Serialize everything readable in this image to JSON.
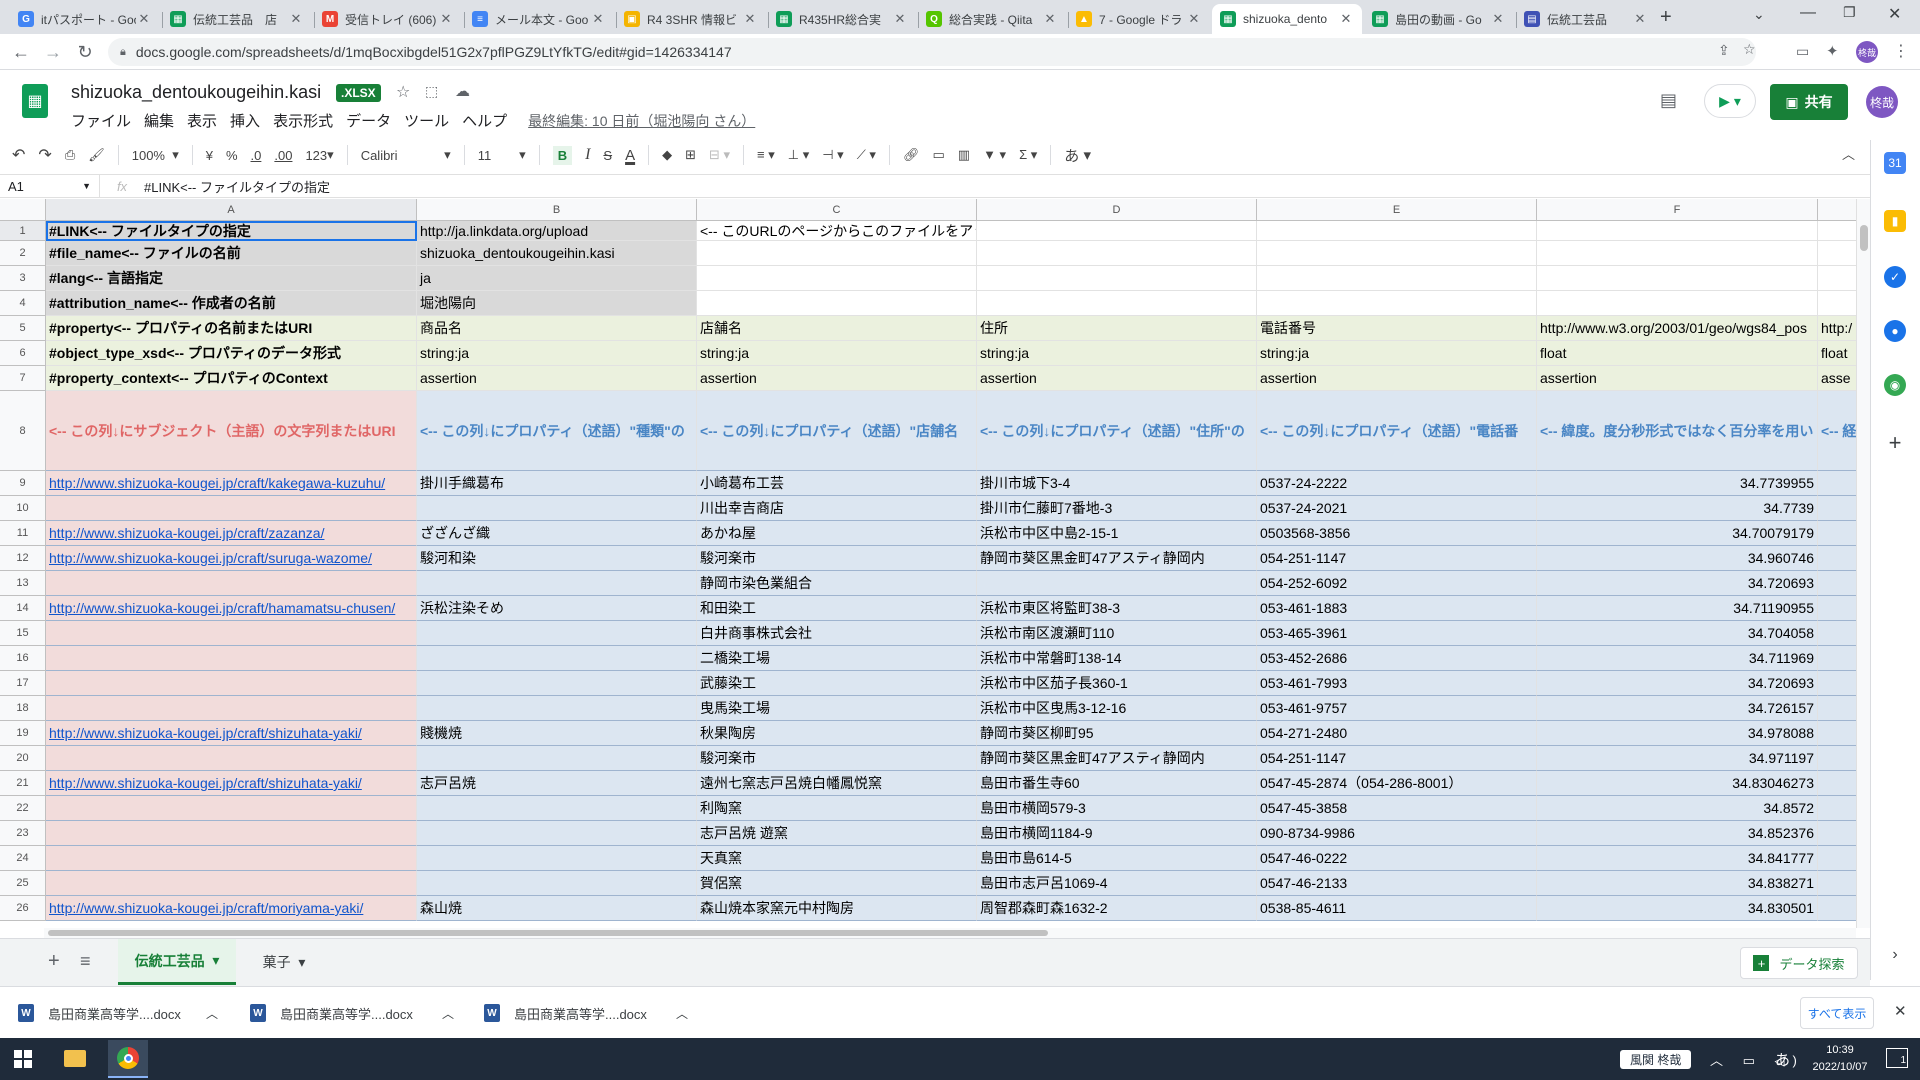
{
  "browser": {
    "tabs": [
      {
        "label": "itパスポート - Goo",
        "color": "#4285f4",
        "glyph": "G"
      },
      {
        "label": "伝統工芸品　店",
        "color": "#0f9d58",
        "glyph": "▦"
      },
      {
        "label": "受信トレイ (606)",
        "color": "#ea4335",
        "glyph": "M"
      },
      {
        "label": "メール本文 - Goo",
        "color": "#4285f4",
        "glyph": "≡"
      },
      {
        "label": "R4 3SHR 情報ビ",
        "color": "#f4b400",
        "glyph": "▣"
      },
      {
        "label": "R435HR総合実",
        "color": "#0f9d58",
        "glyph": "▦"
      },
      {
        "label": "総合実践 - Qiita",
        "color": "#55c500",
        "glyph": "Q"
      },
      {
        "label": "7 - Google ドラ",
        "color": "#fbbc04",
        "glyph": "▲"
      },
      {
        "label": "shizuoka_dento",
        "color": "#0f9d58",
        "glyph": "▦"
      },
      {
        "label": "島田の動画 - Go",
        "color": "#0f9d58",
        "glyph": "▦"
      },
      {
        "label": "伝統工芸品",
        "color": "#3f51b5",
        "glyph": "▤"
      }
    ],
    "url": "docs.google.com/spreadsheets/d/1mqBocxibgdel51G2x7pflPGZ9LtYfkTG/edit#gid=1426334147",
    "new_tab": "+",
    "profile_initials": "柊哉"
  },
  "sheets": {
    "doc_title": "shizuoka_dentoukougeihin.kasi",
    "badge": ".XLSX",
    "menu": [
      "ファイル",
      "編集",
      "表示",
      "挿入",
      "表示形式",
      "データ",
      "ツール",
      "ヘルプ"
    ],
    "last_edit": "最終編集: 10 日前（堀池陽向 さん）",
    "share_label": "共有",
    "avatar": "柊哉"
  },
  "toolbar": {
    "zoom": "100%",
    "currency": "¥",
    "percent": "%",
    "dec_less": ".0",
    "dec_more": ".00",
    "format_num": "123",
    "font": "Calibri",
    "size": "11",
    "bold": "B",
    "italic": "I",
    "strike": "S",
    "text_color": "A",
    "input_tool": "あ"
  },
  "formula_bar": {
    "cell_ref": "A1",
    "fx": "fx",
    "content": "#LINK<-- ファイルタイプの指定"
  },
  "grid": {
    "columns": [
      "A",
      "B",
      "C",
      "D",
      "E",
      "F"
    ],
    "rows": [
      {
        "n": "1",
        "a": "#LINK<-- ファイルタイプの指定",
        "b": "http://ja.linkdata.org/upload",
        "c": "<-- このURLのページからこのファイルをアップロードしてください。",
        "d": "",
        "e": "",
        "f": "",
        "g": ""
      },
      {
        "n": "2",
        "a": "#file_name<-- ファイルの名前",
        "b": "shizuoka_dentoukougeihin.kasi",
        "c": "",
        "d": "",
        "e": "",
        "f": "",
        "g": ""
      },
      {
        "n": "3",
        "a": "#lang<-- 言語指定",
        "b": "ja",
        "c": "",
        "d": "",
        "e": "",
        "f": "",
        "g": ""
      },
      {
        "n": "4",
        "a": "#attribution_name<-- 作成者の名前",
        "b": "堀池陽向",
        "c": "",
        "d": "",
        "e": "",
        "f": "",
        "g": ""
      },
      {
        "n": "5",
        "a": "#property<-- プロパティの名前またはURI",
        "b": "商品名",
        "c": "店舗名",
        "d": "住所",
        "e": "電話番号",
        "f": "http://www.w3.org/2003/01/geo/wgs84_pos",
        "g": "http:/"
      },
      {
        "n": "6",
        "a": "#object_type_xsd<-- プロパティのデータ形式",
        "b": "string:ja",
        "c": "string:ja",
        "d": "string:ja",
        "e": "string:ja",
        "f": "float",
        "g": "float"
      },
      {
        "n": "7",
        "a": "#property_context<-- プロパティのContext",
        "b": "assertion",
        "c": "assertion",
        "d": "assertion",
        "e": "assertion",
        "f": "assertion",
        "g": "asse"
      },
      {
        "n": "8",
        "a": "<-- この列↓にサブジェクト（主語）の文字列またはURI",
        "b": "<-- この列↓にプロパティ（述語）\"種類\"の",
        "c": "<-- この列↓にプロパティ（述語）\"店舗名",
        "d": "<-- この列↓にプロパティ（述語）\"住所\"の",
        "e": "<-- この列↓にプロパティ（述語）\"電話番",
        "f": "<-- 緯度。度分秒形式ではなく百分率を用い",
        "g": "<-- 経"
      },
      {
        "n": "9",
        "a": "http://www.shizuoka-kougei.jp/craft/kakegawa-kuzuhu/",
        "b": "掛川手織葛布",
        "c": "小崎葛布工芸",
        "d": "掛川市城下3-4",
        "e": "0537-24-2222",
        "f": "34.7739955",
        "g": ""
      },
      {
        "n": "10",
        "a": "",
        "b": "",
        "c": "川出幸吉商店",
        "d": "掛川市仁藤町7番地-3",
        "e": "0537-24-2021",
        "f": "34.7739",
        "g": ""
      },
      {
        "n": "11",
        "a": "http://www.shizuoka-kougei.jp/craft/zazanza/",
        "b": "ざざんざ織",
        "c": "あかね屋",
        "d": "浜松市中区中島2-15-1",
        "e": "0503568-3856",
        "f": "34.70079179",
        "g": ""
      },
      {
        "n": "12",
        "a": "http://www.shizuoka-kougei.jp/craft/suruga-wazome/",
        "b": "駿河和染",
        "c": "駿河楽市",
        "d": "静岡市葵区黒金町47アスティ静岡内",
        "e": "054-251-1147",
        "f": "34.960746",
        "g": ""
      },
      {
        "n": "13",
        "a": "",
        "b": "",
        "c": "静岡市染色業組合",
        "d": "",
        "e": "054-252-6092",
        "f": "34.720693",
        "g": ""
      },
      {
        "n": "14",
        "a": "http://www.shizuoka-kougei.jp/craft/hamamatsu-chusen/",
        "b": "浜松注染そめ",
        "c": "和田染工",
        "d": "浜松市東区将監町38-3",
        "e": "053-461-1883",
        "f": "34.71190955",
        "g": ""
      },
      {
        "n": "15",
        "a": "",
        "b": "",
        "c": "白井商事株式会社",
        "d": "浜松市南区渡瀬町110",
        "e": "053-465-3961",
        "f": "34.704058",
        "g": ""
      },
      {
        "n": "16",
        "a": "",
        "b": "",
        "c": "二橋染工場",
        "d": "浜松市中常磐町138-14",
        "e": "053-452-2686",
        "f": "34.711969",
        "g": ""
      },
      {
        "n": "17",
        "a": "",
        "b": "",
        "c": "武藤染工",
        "d": "浜松市中区茄子長360-1",
        "e": "053-461-7993",
        "f": "34.720693",
        "g": ""
      },
      {
        "n": "18",
        "a": "",
        "b": "",
        "c": "曳馬染工場",
        "d": "浜松市中区曳馬3-12-16",
        "e": "053-461-9757",
        "f": "34.726157",
        "g": ""
      },
      {
        "n": "19",
        "a": "http://www.shizuoka-kougei.jp/craft/shizuhata-yaki/",
        "b": "賤機焼",
        "c": "秋果陶房",
        "d": "静岡市葵区柳町95",
        "e": "054-271-2480",
        "f": "34.978088",
        "g": ""
      },
      {
        "n": "20",
        "a": "",
        "b": "",
        "c": "駿河楽市",
        "d": "静岡市葵区黒金町47アスティ静岡内",
        "e": "054-251-1147",
        "f": "34.971197",
        "g": ""
      },
      {
        "n": "21",
        "a": "http://www.shizuoka-kougei.jp/craft/shizuhata-yaki/",
        "b": "志戸呂焼",
        "c": "遠州七窯志戸呂焼白幡鳳悦窯",
        "d": "島田市番生寺60",
        "e": "0547-45-2874（054-286-8001）",
        "f": "34.83046273",
        "g": ""
      },
      {
        "n": "22",
        "a": "",
        "b": "",
        "c": "利陶窯",
        "d": "島田市横岡579-3",
        "e": "0547-45-3858",
        "f": "34.8572",
        "g": ""
      },
      {
        "n": "23",
        "a": "",
        "b": "",
        "c": "志戸呂焼 遊窯",
        "d": "島田市横岡1184-9",
        "e": "090-8734-9986",
        "f": "34.852376",
        "g": ""
      },
      {
        "n": "24",
        "a": "",
        "b": "",
        "c": "天真窯",
        "d": "島田市島614-5",
        "e": "0547-46-0222",
        "f": "34.841777",
        "g": ""
      },
      {
        "n": "25",
        "a": "",
        "b": "",
        "c": "賀侶窯",
        "d": "島田市志戸呂1069-4",
        "e": "0547-46-2133",
        "f": "34.838271",
        "g": ""
      },
      {
        "n": "26",
        "a": "http://www.shizuoka-kougei.jp/craft/moriyama-yaki/",
        "b": "森山焼",
        "c": "森山焼本家窯元中村陶房",
        "d": "周智郡森町森1632-2",
        "e": "0538-85-4611",
        "f": "34.830501",
        "g": ""
      }
    ]
  },
  "sheet_tabs": {
    "add": "+",
    "list": "≡",
    "tabs": [
      "伝統工芸品",
      "菓子"
    ],
    "explore": "データ探索"
  },
  "downloads": {
    "items": [
      "島田商業高等学....docx",
      "島田商業高等学....docx",
      "島田商業高等学....docx"
    ],
    "show_all": "すべて表示"
  },
  "taskbar": {
    "weather": "風関 柊哉",
    "ime": "あ",
    "time": "10:39",
    "date": "2022/10/07",
    "notif": "1"
  },
  "colors": {
    "header_gray": "#d9d9d9",
    "meta_green": "#ebf1de",
    "desc_row": "#dce6f1",
    "pink": "#f2dcdb",
    "blue": "#dce6f1",
    "sheets_green": "#188038"
  }
}
